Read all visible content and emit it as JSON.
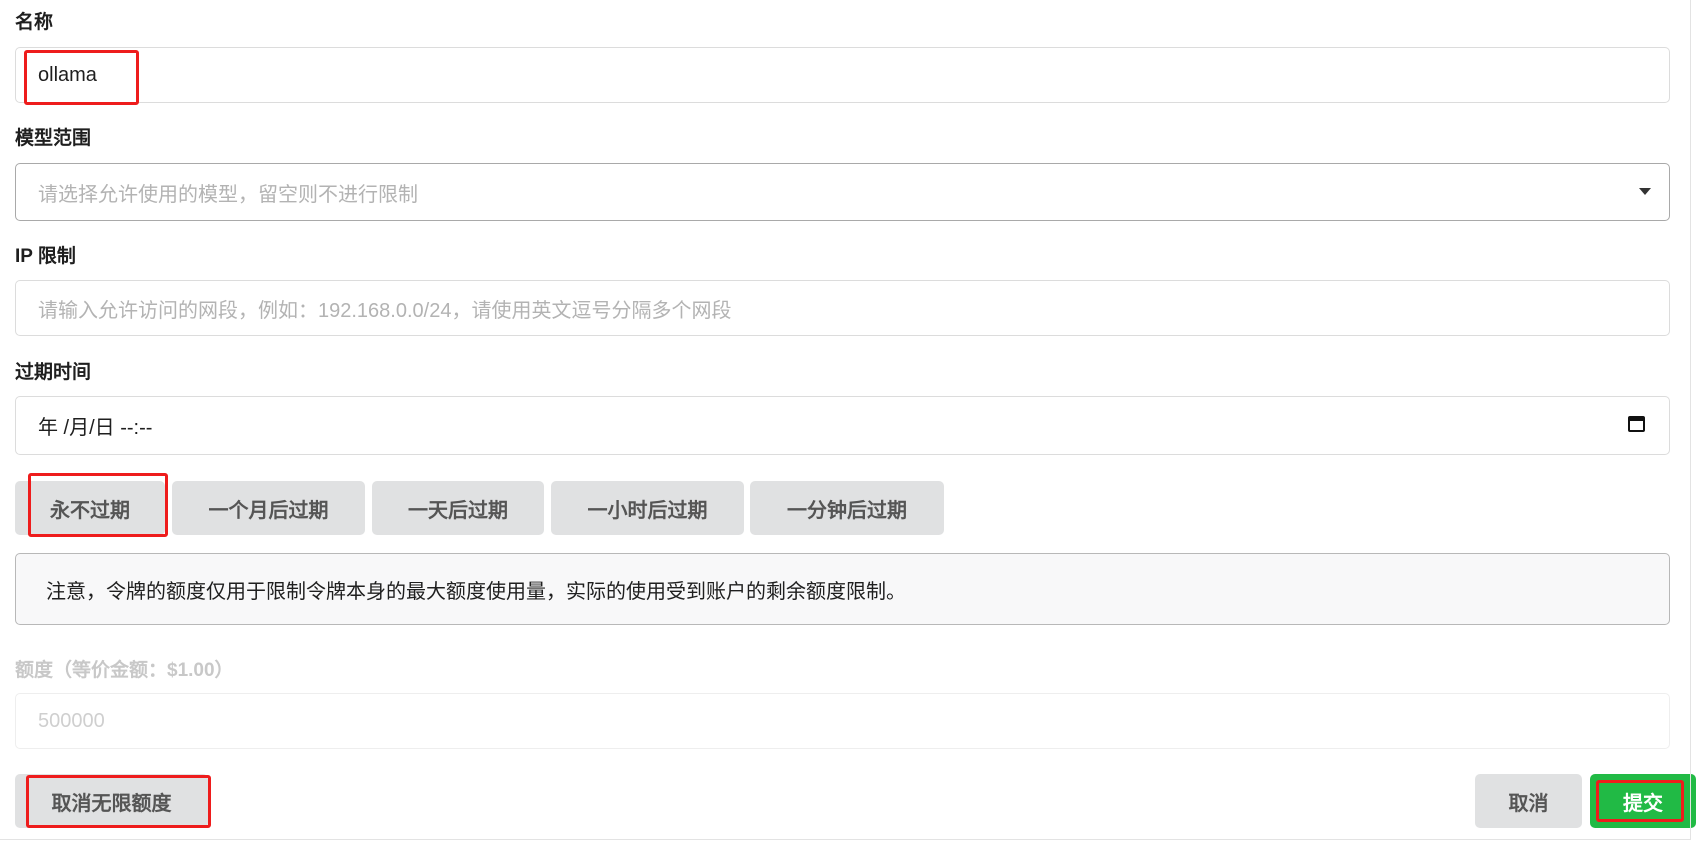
{
  "fields": {
    "name": {
      "label": "名称",
      "value": "ollama"
    },
    "model_scope": {
      "label": "模型范围",
      "placeholder": "请选择允许使用的模型，留空则不进行限制"
    },
    "ip_limit": {
      "label": "IP 限制",
      "placeholder": "请输入允许访问的网段，例如：192.168.0.0/24，请使用英文逗号分隔多个网段"
    },
    "expire_time": {
      "label": "过期时间",
      "value": "年 /月/日 --:--"
    },
    "quota": {
      "label": "额度（等价金额：$1.00）",
      "placeholder": "500000"
    }
  },
  "expire_buttons": [
    "永不过期",
    "一个月后过期",
    "一天后过期",
    "一小时后过期",
    "一分钟后过期"
  ],
  "notice": "注意，令牌的额度仅用于限制令牌本身的最大额度使用量，实际的使用受到账户的剩余额度限制。",
  "actions": {
    "unlimited_quota": "取消无限额度",
    "cancel": "取消",
    "submit": "提交"
  },
  "colors": {
    "highlight": "#ee1c1c",
    "submit_green": "#21ba45",
    "button_gray": "#e0e1e2"
  },
  "icons": {
    "model_scope_dropdown": "chevron-down-icon",
    "expire_time_picker": "calendar-icon"
  }
}
